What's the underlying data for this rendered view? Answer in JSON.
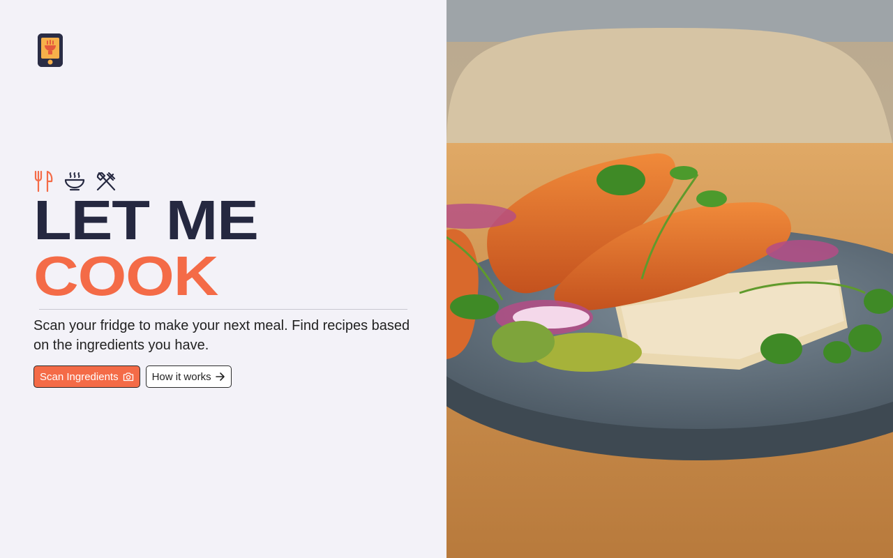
{
  "brand": {
    "logo_icon": "phone-bowl-icon"
  },
  "hero": {
    "icons": [
      "fork-knife-icon",
      "soup-bowl-icon",
      "crossed-utensils-icon"
    ],
    "headline_line1": "LET ME",
    "headline_line2": "COOK",
    "description": "Scan your fridge to make your next meal. Find recipes based on the ingredients you have.",
    "primary_button": {
      "label": "Scan Ingredients",
      "icon": "camera-icon"
    },
    "secondary_button": {
      "label": "How it works",
      "icon": "arrow-right-icon"
    }
  },
  "colors": {
    "accent": "#f46b47",
    "dark": "#252840",
    "background": "#f3f2f8",
    "logo_yellow": "#f6b04a"
  },
  "image": {
    "description_icon": "salmon-dish-photo"
  }
}
